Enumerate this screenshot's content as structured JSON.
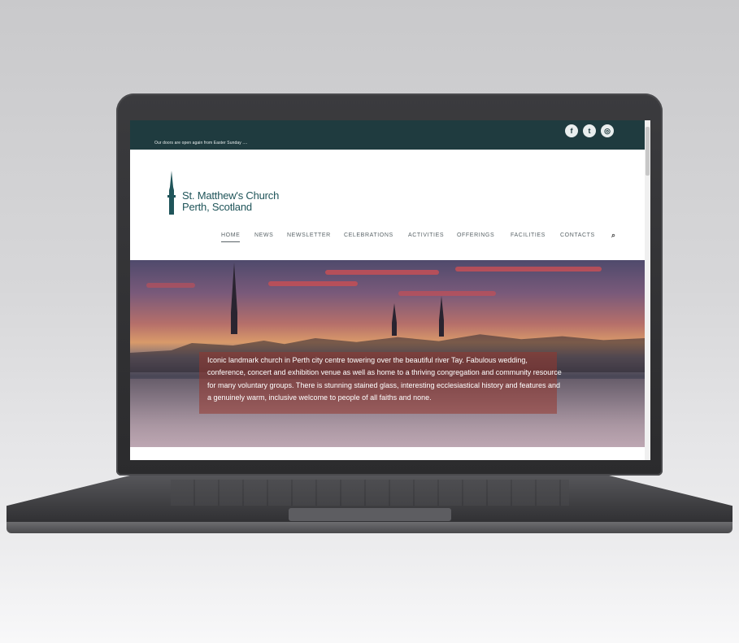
{
  "site": {
    "announcement": "Our doors are open again from Easter Sunday ....",
    "logo_line1": "St. Matthew's Church",
    "logo_line2": "Perth, Scotland"
  },
  "social": {
    "facebook_icon": "facebook-icon",
    "twitter_icon": "twitter-icon",
    "instagram_icon": "instagram-icon"
  },
  "nav": {
    "items": [
      {
        "label": "HOME",
        "active": true
      },
      {
        "label": "NEWS"
      },
      {
        "label": "NEWSLETTER"
      },
      {
        "label": "CELEBRATIONS"
      },
      {
        "label": "ACTIVITIES"
      },
      {
        "label": "OFFERINGS"
      },
      {
        "label": "FACILITIES"
      },
      {
        "label": "CONTACTS"
      }
    ],
    "search_icon": "search-icon"
  },
  "hero": {
    "caption": "Iconic landmark church in Perth city centre towering over the beautiful river Tay. Fabulous wedding, conference, concert and exhibition venue as well as home to a thriving congregation and community resource for many voluntary groups. There is stunning stained glass, interesting ecclesiastical history and features and a genuinely warm, inclusive welcome to people of all faiths and none."
  },
  "colors": {
    "topbar": "#1f3b3f",
    "logo": "#20555a",
    "caption_box": "#96372d"
  }
}
